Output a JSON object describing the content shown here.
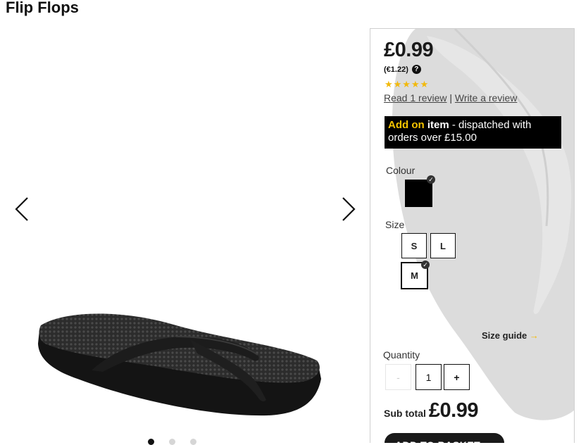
{
  "page": {
    "title": "Flip Flops"
  },
  "gallery": {
    "prev_icon": "chevron-left-icon",
    "next_icon": "chevron-right-icon",
    "image_alt": "black-flip-flop",
    "dots": [
      {
        "active": true
      },
      {
        "active": false
      },
      {
        "active": false
      }
    ]
  },
  "purchase": {
    "price": "£0.99",
    "price_alt": "(€1.22)",
    "help_icon": "?",
    "rating_stars": 5,
    "stars_text": "★★★★★",
    "reviews": {
      "read_label": "Read 1 review",
      "separator": "|",
      "write_label": "Write a review"
    },
    "addon": {
      "highlight": "Add on",
      "item": "item",
      "rest_line1": " - dispatched with",
      "line2": "orders over £15.00"
    },
    "colour": {
      "label": "Colour",
      "selected_color": "#000000"
    },
    "size": {
      "label": "Size",
      "options": [
        "S",
        "L",
        "M"
      ],
      "selected": "M"
    },
    "size_guide": {
      "label": "Size guide",
      "arrow": "→"
    },
    "quantity": {
      "label": "Quantity",
      "minus": "-",
      "value": "1",
      "plus": "+"
    },
    "subtotal": {
      "label": "Sub total",
      "value": "£0.99"
    },
    "add_to_basket": "ADD TO BASKET →"
  },
  "colors": {
    "accent_yellow": "#f5c400",
    "star_color": "#f2b90c",
    "dark": "#111111"
  }
}
